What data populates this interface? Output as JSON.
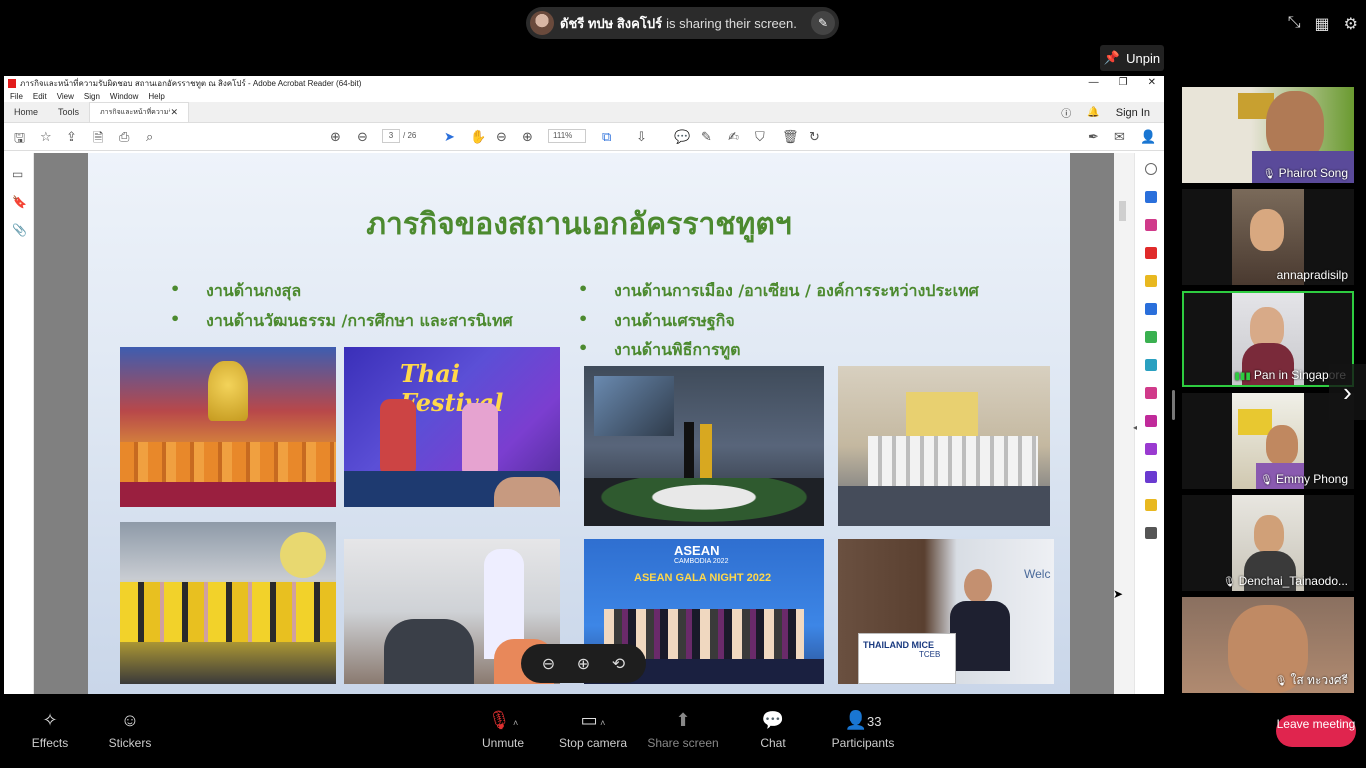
{
  "banner": {
    "sharer_name": "ดัชรี ทปษ สิงคโปร์",
    "suffix": "is sharing their screen."
  },
  "unpin_label": "Unpin",
  "acrobat": {
    "window_title": "ภารกิจและหน้าที่ความรับผิดชอบ สถานเอกอัครราชทูต ณ สิงคโปร์ - Adobe Acrobat Reader (64-bit)",
    "menu": [
      "File",
      "Edit",
      "View",
      "Sign",
      "Window",
      "Help"
    ],
    "tabs": {
      "home": "Home",
      "tools": "Tools",
      "doc": "ภารกิจและหน้าที่ความรั..."
    },
    "sign_in": "Sign In",
    "page_current": "3",
    "page_total": "/ 26",
    "zoom": "111%"
  },
  "slide": {
    "title": "ภารกิจของสถานเอกอัครราชทูตฯ",
    "left_bullets": [
      "งานด้านกงสุล",
      "งานด้านวัฒนธรรม /การศึกษา และสารนิเทศ"
    ],
    "right_bullets": [
      "งานด้านการเมือง /อาเซียน / องค์การระหว่างประเทศ",
      "งานด้านเศรษฐกิจ",
      "งานด้านพิธีการทูต"
    ],
    "poster_text": "Thai Festival",
    "asean_title": "ASEAN",
    "asean_sub": "CAMBODIA 2022",
    "asean_gala": "ASEAN GALA NIGHT 2022",
    "mice_text": "THAILAND MICE",
    "tceb_text": "TCEB",
    "welcome_text": "Welc"
  },
  "participants": [
    {
      "name": "Phairot Song",
      "muted": true
    },
    {
      "name": "annapradisilp",
      "muted": false
    },
    {
      "name": "Pan in Singapore",
      "muted": false,
      "speaking": true
    },
    {
      "name": "Emmy Phong",
      "muted": true
    },
    {
      "name": "Denchai_Tainaodo...",
      "muted": true
    },
    {
      "name": "ใส ทะวงศรี",
      "muted": true
    }
  ],
  "toolbar": {
    "effects": "Effects",
    "stickers": "Stickers",
    "unmute": "Unmute",
    "stop_camera": "Stop camera",
    "share_screen": "Share screen",
    "chat": "Chat",
    "participants": "Participants",
    "participant_count": "33",
    "leave": "Leave meeting"
  },
  "colors": {
    "slide_title": "#4c8a2f",
    "speaking_border": "#2ecc40",
    "leave_button": "#e0254e",
    "mute_icon": "#e03030"
  }
}
